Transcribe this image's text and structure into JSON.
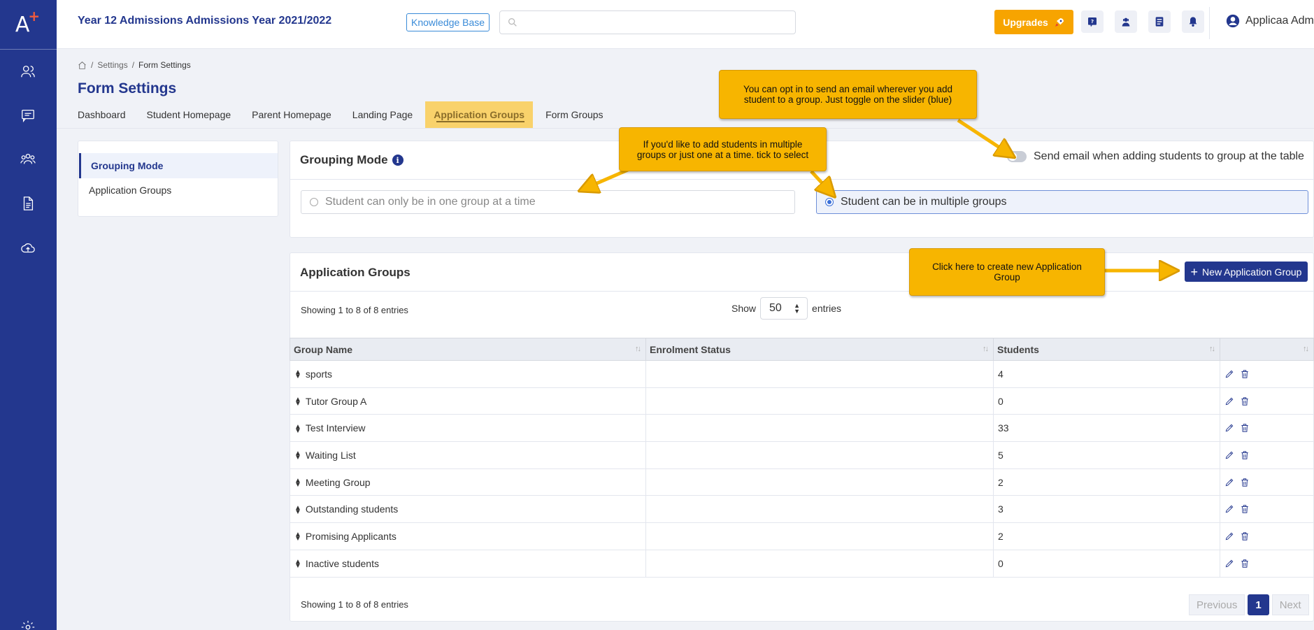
{
  "app": {
    "logo_letter": "A",
    "logo_plus": "+",
    "title": "Year 12 Admissions Admissions Year 2021/2022",
    "knowledge_base": "Knowledge Base",
    "search_placeholder": "",
    "upgrade_label": "Upgrades",
    "user_name": "Applicaa Adm"
  },
  "breadcrumb": {
    "settings": "Settings",
    "current": "Form Settings",
    "sep": "/"
  },
  "page": {
    "title": "Form Settings"
  },
  "tabs": [
    "Dashboard",
    "Student Homepage",
    "Parent Homepage",
    "Landing Page",
    "Application Groups",
    "Form Groups"
  ],
  "left_menu": {
    "items": [
      "Grouping Mode",
      "Application Groups"
    ]
  },
  "grouping_mode": {
    "title": "Grouping Mode",
    "info": "i",
    "toggle_label": "Send email when adding students to group at the table",
    "option_single": "Student can only be in one group at a time",
    "option_multiple": "Student can be in multiple groups"
  },
  "application_groups": {
    "title": "Application Groups",
    "new_button": "New Application Group",
    "new_icon": "+",
    "showing_text": "Showing 1 to 8 of 8 entries",
    "show_label": "Show",
    "entries_label": "entries",
    "page_size": "50",
    "columns": [
      "Group Name",
      "Enrolment Status",
      "Students",
      ""
    ],
    "rows": [
      {
        "name": "sports",
        "status": "",
        "students": "4"
      },
      {
        "name": "Tutor Group A",
        "status": "",
        "students": "0"
      },
      {
        "name": "Test Interview",
        "status": "",
        "students": "33"
      },
      {
        "name": "Waiting List",
        "status": "",
        "students": "5"
      },
      {
        "name": "Meeting Group",
        "status": "",
        "students": "2"
      },
      {
        "name": "Outstanding students",
        "status": "",
        "students": "3"
      },
      {
        "name": "Promising Applicants",
        "status": "",
        "students": "2"
      },
      {
        "name": "Inactive students",
        "status": "",
        "students": "0"
      }
    ],
    "pager": {
      "previous": "Previous",
      "current": "1",
      "next": "Next"
    }
  },
  "callouts": {
    "email": "You can opt in to send an email wherever you add student to a group. Just toggle on the slider (blue)",
    "multiple": "If you'd like to add students in multiple groups or just one at a time.  tick to select",
    "new_group": "Click here to create new Application Group"
  },
  "colors": {
    "sidebar": "#23378e",
    "accent": "#23378e",
    "upgrade": "#f7a400",
    "callout": "#f7b500"
  }
}
